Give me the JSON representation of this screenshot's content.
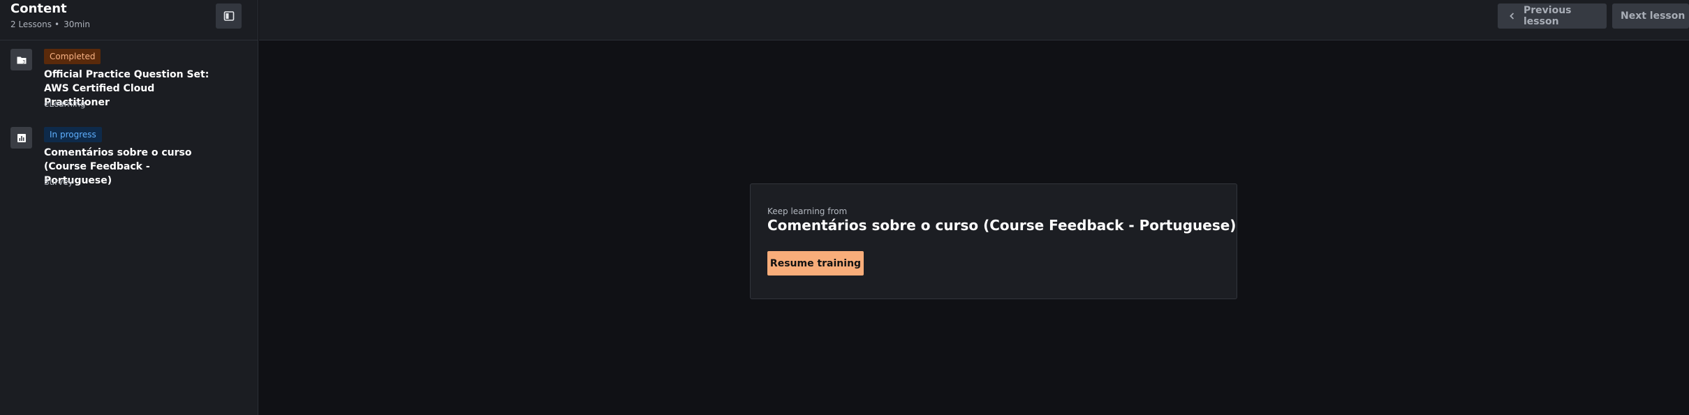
{
  "sidebar": {
    "title": "Content",
    "lesson_count": "2 Lessons",
    "meta_separator": "•",
    "duration": "30min",
    "collapse_icon": "sidebar-collapse-icon",
    "lessons": [
      {
        "status": "Completed",
        "title": "Official Practice Question Set: AWS Certified Cloud Practitioner",
        "type": "eLearning",
        "icon": "folder-icon"
      },
      {
        "status": "In progress",
        "title": "Comentários sobre o curso (Course Feedback - Portuguese)",
        "type": "Survey",
        "icon": "bar-chart-icon"
      }
    ]
  },
  "topbar": {
    "previous_label": "Previous lesson",
    "next_label": "Next lesson"
  },
  "resume": {
    "label": "Keep learning from",
    "title": "Comentários sobre o curso (Course Feedback - Portuguese)",
    "button_label": "Resume training"
  },
  "colors": {
    "accent": "#f8ad7a",
    "completed_badge_bg": "#5a2a0b",
    "completed_badge_text": "#f7b183",
    "progress_badge_bg": "#0e2a4a",
    "progress_badge_text": "#5fb0ff",
    "background": "#101115",
    "panel": "#1b1d22"
  }
}
